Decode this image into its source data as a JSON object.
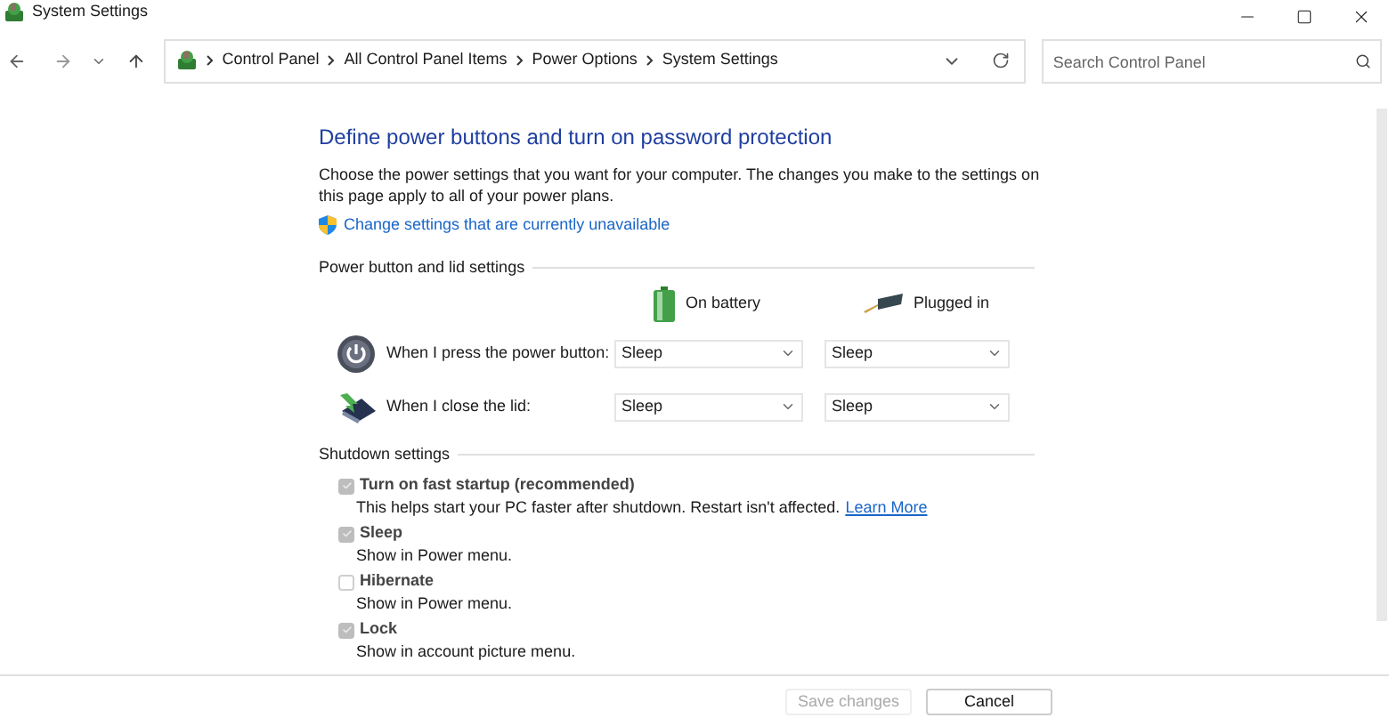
{
  "window": {
    "title": "System Settings"
  },
  "breadcrumb": [
    "Control Panel",
    "All Control Panel Items",
    "Power Options",
    "System Settings"
  ],
  "search": {
    "placeholder": "Search Control Panel"
  },
  "heading": "Define power buttons and turn on password protection",
  "intro": "Choose the power settings that you want for your computer. The changes you make to the settings on this page apply to all of your power plans.",
  "change_link": "Change settings that are currently unavailable",
  "power_section": {
    "title": "Power button and lid settings",
    "columns": [
      "On battery",
      "Plugged in"
    ],
    "rows": [
      {
        "kind": "power",
        "label": "When I press the power button:",
        "values": [
          "Sleep",
          "Sleep"
        ]
      },
      {
        "kind": "lid",
        "label": "When I close the lid:",
        "values": [
          "Sleep",
          "Sleep"
        ]
      }
    ]
  },
  "shutdown_section": {
    "title": "Shutdown settings",
    "items": [
      {
        "label": "Turn on fast startup (recommended)",
        "description": "This helps start your PC faster after shutdown. Restart isn't affected.",
        "link": "Learn More",
        "checked": true
      },
      {
        "label": "Sleep",
        "description": "Show in Power menu.",
        "checked": true
      },
      {
        "label": "Hibernate",
        "description": "Show in Power menu.",
        "checked": false
      },
      {
        "label": "Lock",
        "description": "Show in account picture menu.",
        "checked": true
      }
    ]
  },
  "buttons": [
    {
      "label": "Save changes",
      "disabled": true
    },
    {
      "label": "Cancel",
      "disabled": false
    }
  ]
}
